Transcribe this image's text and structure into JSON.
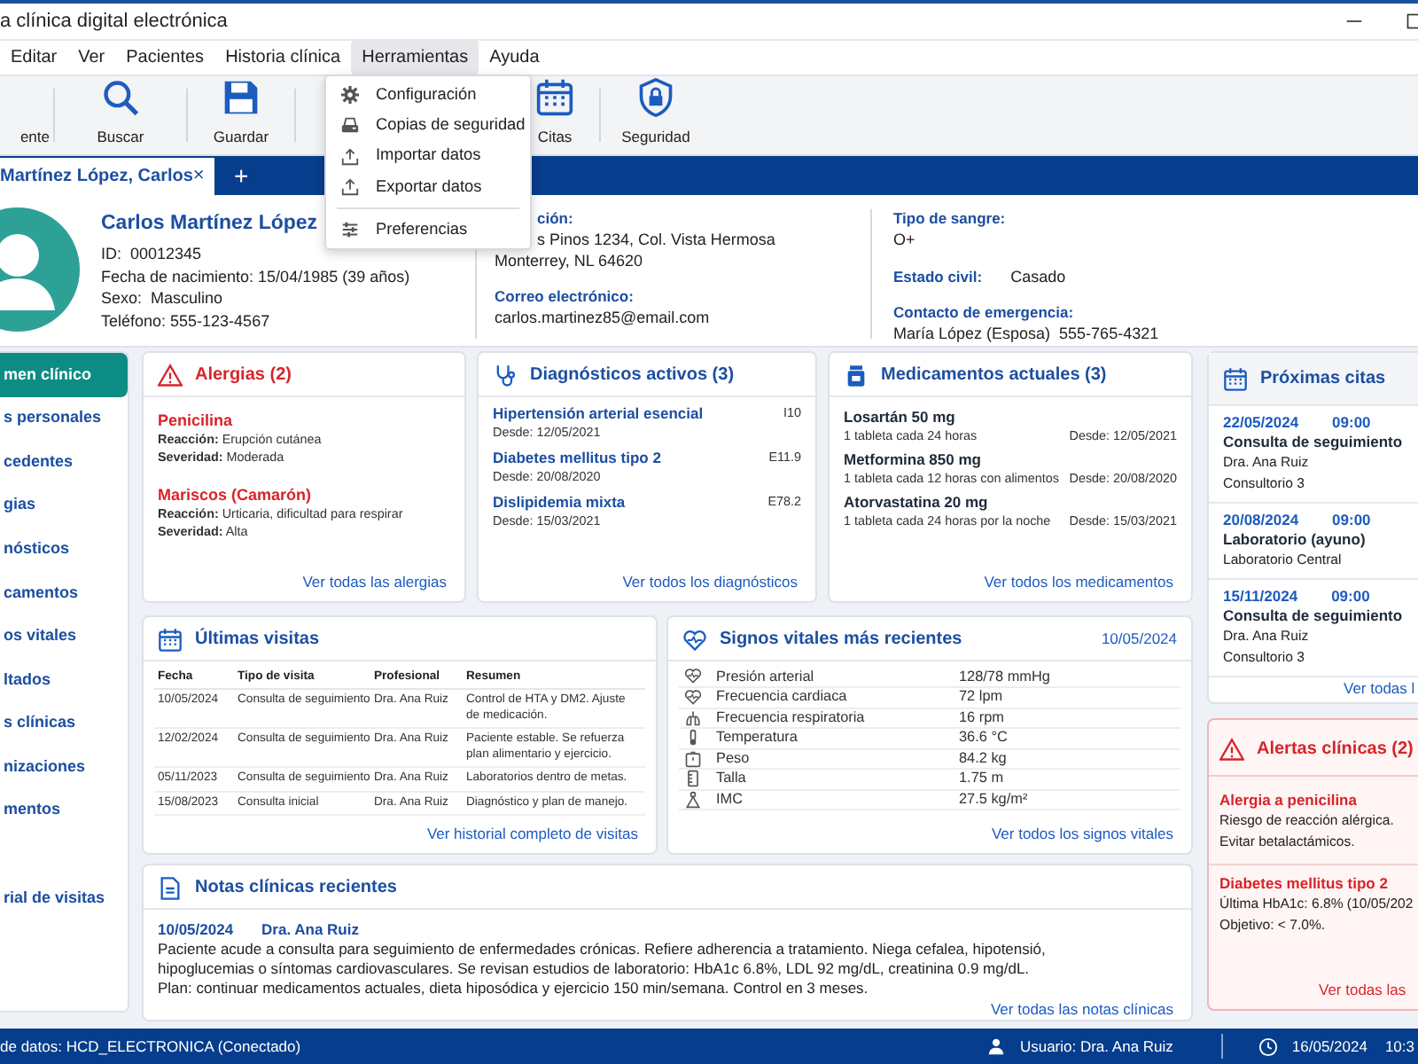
{
  "window": {
    "title": "a clínica digital electrónica"
  },
  "menu_bar": [
    {
      "label": "Editar",
      "selected": false
    },
    {
      "label": "Ver",
      "selected": false
    },
    {
      "label": "Pacientes",
      "selected": false
    },
    {
      "label": "Historia clínica",
      "selected": false
    },
    {
      "label": "Herramientas",
      "selected": true
    },
    {
      "label": "Ayuda",
      "selected": false
    }
  ],
  "dropdown": [
    {
      "kind": "item",
      "label": "Configuración"
    },
    {
      "kind": "item",
      "label": "Copias de seguridad"
    },
    {
      "kind": "item",
      "label": "Importar datos"
    },
    {
      "kind": "item",
      "label": "Exportar datos"
    },
    {
      "kind": "separator"
    },
    {
      "kind": "item",
      "label": "Preferencias"
    }
  ],
  "toolbar": [
    {
      "label": "ente"
    },
    {
      "label": "Buscar"
    },
    {
      "label": "Guardar"
    },
    {
      "label": "Citas"
    },
    {
      "label": "Seguridad"
    }
  ],
  "tabs": [
    {
      "label": "Martínez López, Carlos",
      "selected": true,
      "close": "×"
    }
  ],
  "new_tab": "+",
  "patient": {
    "name": "Carlos Martínez López",
    "fields": [
      {
        "label": "ID:",
        "value": "00012345"
      },
      {
        "label": "Fecha de nacimiento:",
        "value": "15/04/1985 (39 años)"
      },
      {
        "label": "Sexo:",
        "value": "Masculino"
      },
      {
        "label": "Teléfono:",
        "value": "555-123-4567"
      }
    ],
    "address_label": "ción:",
    "address": [
      "s Pinos 1234, Col. Vista Hermosa",
      "Monterrey, NL 64620"
    ],
    "email_label": "Correo electrónico:",
    "email": "carlos.martinez85@email.com",
    "blood_label": "Tipo de sangre:",
    "blood": "O+",
    "civil_label": "Estado civil:",
    "civil": "Casado",
    "emergency_label": "Contacto de emergencia:",
    "emergency": "María López (Esposa)  555-765-4321"
  },
  "sidebar": {
    "items": [
      {
        "label": "men clínico",
        "selected": true
      },
      {
        "label": "s personales",
        "selected": false
      },
      {
        "label": "cedentes",
        "selected": false
      },
      {
        "label": "gias",
        "selected": false
      },
      {
        "label": "nósticos",
        "selected": false
      },
      {
        "label": "camentos",
        "selected": false
      },
      {
        "label": "os vitales",
        "selected": false
      },
      {
        "label": "ltados",
        "selected": false
      },
      {
        "label": "s clínicas",
        "selected": false
      },
      {
        "label": "nizaciones",
        "selected": false
      },
      {
        "label": "mentos",
        "selected": false
      },
      {
        "label": "rial de visitas",
        "selected": false
      }
    ]
  },
  "allergies": {
    "title": "Alergias (2)",
    "items": [
      {
        "name": "Penicilina",
        "lines": [
          "**Reacción:** Erupción cutánea",
          "**Severidad:** Moderada"
        ]
      },
      {
        "name": "Mariscos (Camarón)",
        "lines": [
          "**Reacción:** Urticaria, dificultad para respirar",
          "**Severidad:** Alta"
        ]
      }
    ],
    "link": "Ver todas las alergias"
  },
  "diagnoses": {
    "title": "Diagnósticos activos (3)",
    "items": [
      {
        "name": "Hipertensión arterial esencial",
        "code": "I10",
        "since": "Desde: 12/05/2021"
      },
      {
        "name": "Diabetes mellitus tipo 2",
        "code": "E11.9",
        "since": "Desde: 20/08/2020"
      },
      {
        "name": "Dislipidemia mixta",
        "code": "E78.2",
        "since": "Desde: 15/03/2021"
      }
    ],
    "link": "Ver todos los diagnósticos"
  },
  "medications": {
    "title": "Medicamentos actuales (3)",
    "items": [
      {
        "name": "Losartán 50 mg",
        "dose": "1 tableta cada 24 horas",
        "since": "Desde: 12/05/2021"
      },
      {
        "name": "Metformina 850 mg",
        "dose": "1 tableta cada 12 horas con alimentos",
        "since": "Desde: 20/08/2020"
      },
      {
        "name": "Atorvastatina 20 mg",
        "dose": "1 tableta cada 24 horas por la noche",
        "since": "Desde: 15/03/2021"
      }
    ],
    "link": "Ver todos los medicamentos"
  },
  "appointments": {
    "title": "Próximas citas",
    "items": [
      {
        "date": "22/05/2024",
        "time": "09:00",
        "title": "Consulta de seguimiento",
        "lines": [
          "Dra. Ana Ruiz",
          "Consultorio 3"
        ]
      },
      {
        "date": "20/08/2024",
        "time": "09:00",
        "title": "Laboratorio (ayuno)",
        "lines": [
          "Laboratorio Central"
        ]
      },
      {
        "date": "15/11/2024",
        "time": "09:00",
        "title": "Consulta de seguimiento",
        "lines": [
          "Dra. Ana Ruiz",
          "Consultorio 3"
        ]
      }
    ],
    "link": "Ver todas l"
  },
  "visits": {
    "title": "Últimas visitas",
    "columns": [
      "Fecha",
      "Tipo de visita",
      "Profesional",
      "Resumen"
    ],
    "rows": [
      [
        "10/05/2024",
        "Consulta de seguimiento",
        "Dra. Ana Ruiz",
        "Control de HTA y DM2. Ajuste de medicación."
      ],
      [
        "12/02/2024",
        "Consulta de seguimiento",
        "Dra. Ana Ruiz",
        "Paciente estable. Se refuerza plan alimentario y ejercicio."
      ],
      [
        "05/11/2023",
        "Consulta de seguimiento",
        "Dra. Ana Ruiz",
        "Laboratorios dentro de metas."
      ],
      [
        "15/08/2023",
        "Consulta inicial",
        "Dra. Ana Ruiz",
        "Diagnóstico y plan de manejo."
      ]
    ],
    "link": "Ver historial completo de visitas"
  },
  "vitals": {
    "title": "Signos vitales más recientes",
    "date": "10/05/2024",
    "rows": [
      {
        "label": "Presión arterial",
        "value": "128/78 mmHg"
      },
      {
        "label": "Frecuencia cardiaca",
        "value": "72 lpm"
      },
      {
        "label": "Frecuencia respiratoria",
        "value": "16 rpm"
      },
      {
        "label": "Temperatura",
        "value": "36.6 °C"
      },
      {
        "label": "Peso",
        "value": "84.2 kg"
      },
      {
        "label": "Talla",
        "value": "1.75 m"
      },
      {
        "label": "IMC",
        "value": "27.5 kg/m²"
      }
    ],
    "link": "Ver todos los signos vitales"
  },
  "alerts": {
    "title": "Alertas clínicas (2)",
    "items": [
      {
        "name": "Alergia a penicilina",
        "lines": [
          "Riesgo de reacción alérgica.",
          "Evitar betalactámicos."
        ]
      },
      {
        "name": "Diabetes mellitus tipo 2",
        "lines": [
          "Última HbA1c: 6.8% (10/05/202",
          "Objetivo: < 7.0%."
        ]
      }
    ],
    "link": "Ver todas las"
  },
  "notes": {
    "title": "Notas clínicas recientes",
    "date": "10/05/2024",
    "author": "Dra. Ana Ruiz",
    "lines": [
      "Paciente acude a consulta para seguimiento de enfermedades crónicas. Refiere adherencia a tratamiento. Niega cefalea, hipotensió,",
      "hipoglucemias o síntomas cardiovasculares. Se revisan estudios de laboratorio: HbA1c 6.8%, LDL 92 mg/dL, creatinina 0.9 mg/dL.",
      "Plan: continuar medicamentos actuales, dieta hiposódica y ejercicio 150 min/semana. Control en 3 meses."
    ],
    "link": "Ver todas las notas clínicas"
  },
  "status_bar": {
    "database": "de datos: HCD_ELECTRONICA (Conectado)",
    "user": "Usuario: Dra. Ana Ruiz",
    "date": "16/05/2024",
    "time": "10:3"
  }
}
